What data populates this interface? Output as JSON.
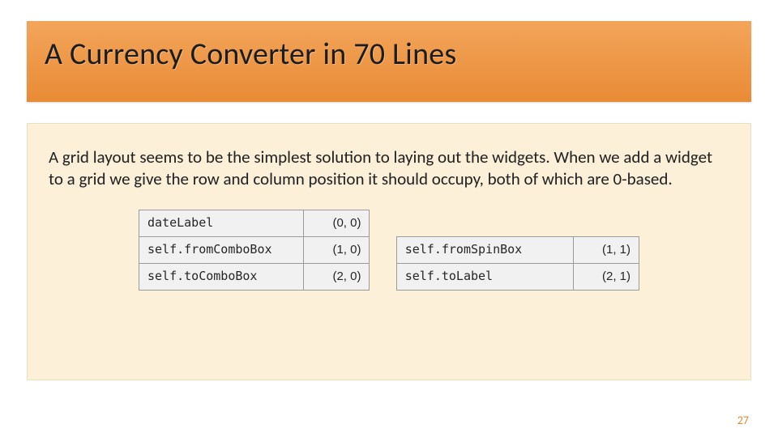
{
  "title": "A Currency Converter in 70 Lines",
  "body_text": "A grid layout seems to be the simplest solution to laying out the widgets. When we add a widget to a grid we give the row and column position it should occupy, both of which are 0-based.",
  "grid": {
    "rows": [
      {
        "left_name": "dateLabel",
        "left_coord": "(0, 0)",
        "right_name": "",
        "right_coord": ""
      },
      {
        "left_name": "self.fromComboBox",
        "left_coord": "(1, 0)",
        "right_name": "self.fromSpinBox",
        "right_coord": "(1, 1)"
      },
      {
        "left_name": "self.toComboBox",
        "left_coord": "(2, 0)",
        "right_name": "self.toLabel",
        "right_coord": "(2, 1)"
      }
    ]
  },
  "page_number": "27"
}
